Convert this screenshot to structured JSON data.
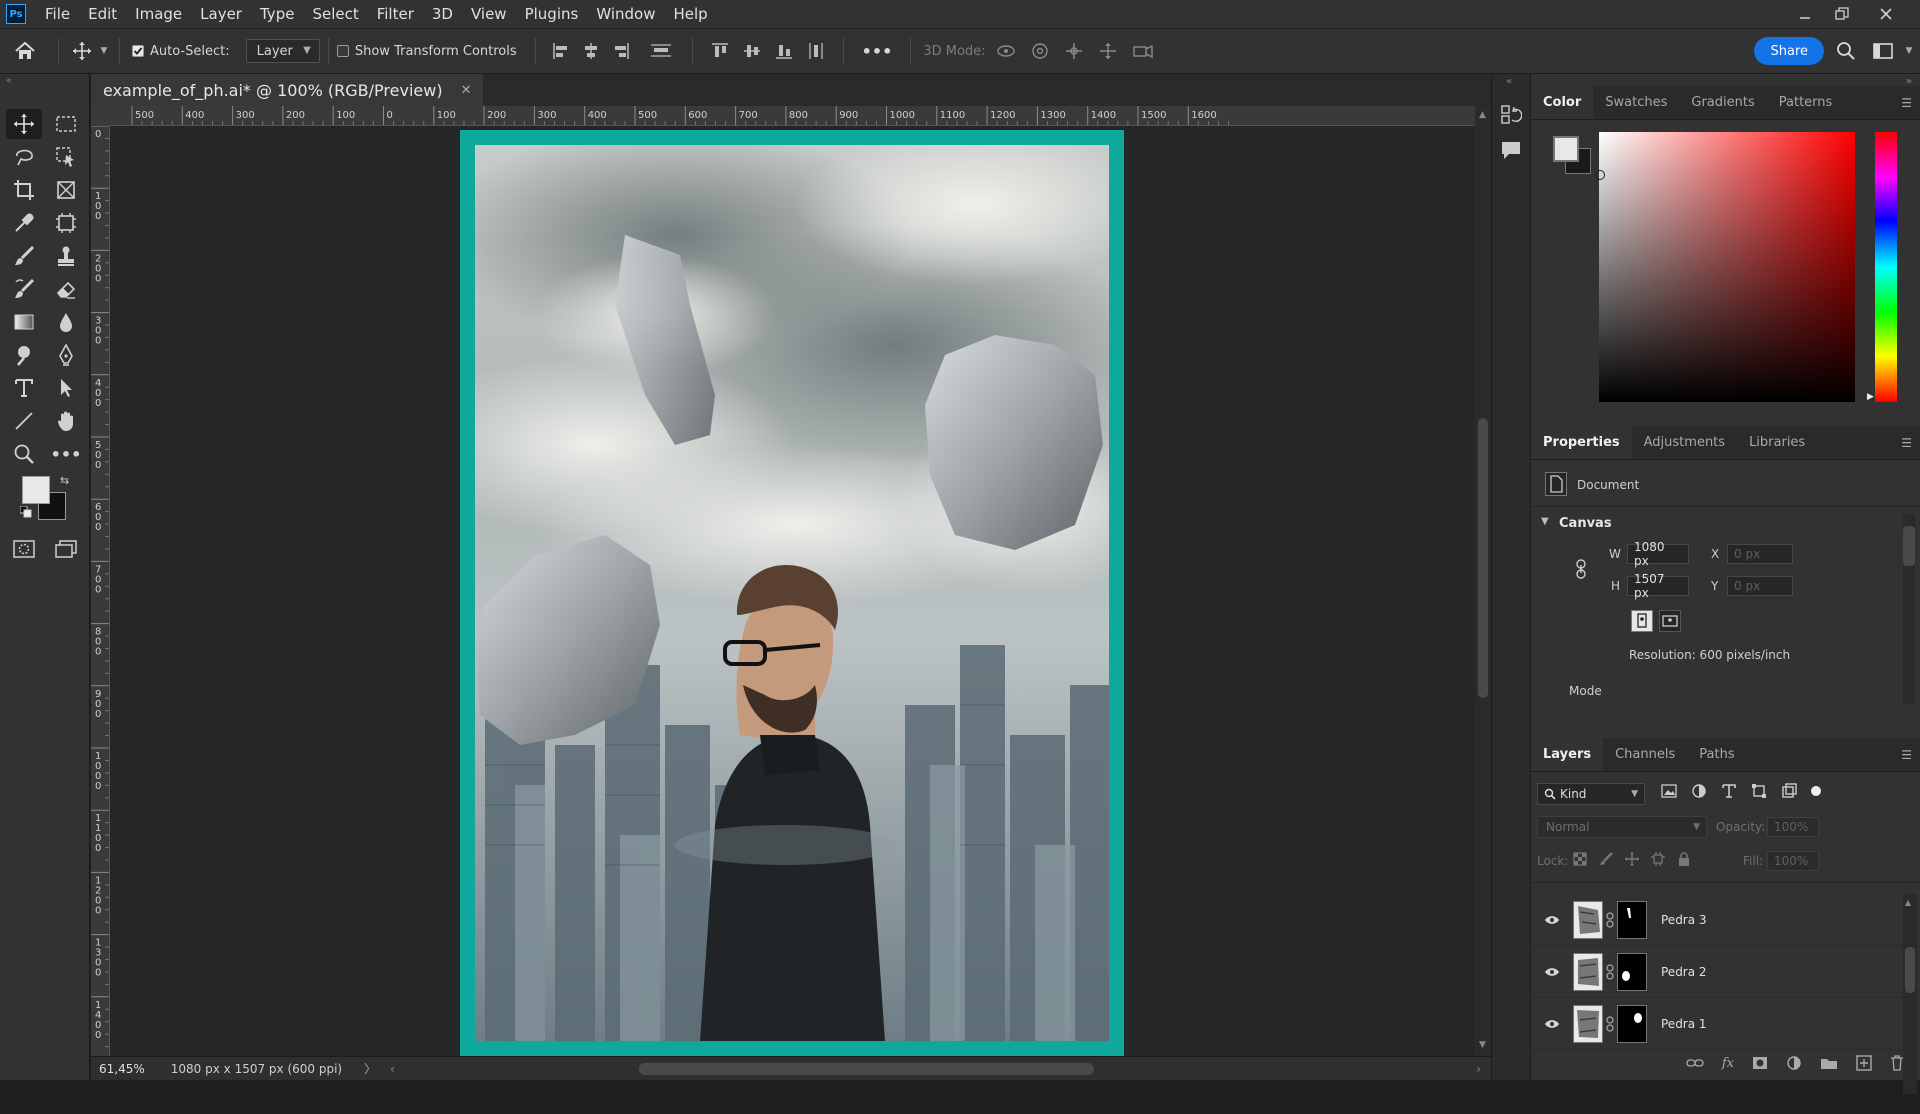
{
  "app": {
    "logo": "Ps"
  },
  "menu": [
    "File",
    "Edit",
    "Image",
    "Layer",
    "Type",
    "Select",
    "Filter",
    "3D",
    "View",
    "Plugins",
    "Window",
    "Help"
  ],
  "options": {
    "auto_select_label": "Auto-Select:",
    "auto_select_checked": true,
    "auto_select_target": "Layer",
    "show_transform_label": "Show Transform Controls",
    "mode_3d_label": "3D Mode:",
    "share_label": "Share",
    "more_label": "•••"
  },
  "document": {
    "tab_title": "example_of_ph.ai* @ 100% (RGB/Preview)",
    "frame_color": "#0fa89c"
  },
  "rulers": {
    "top_ticks": [
      "500",
      "400",
      "300",
      "200",
      "100",
      "0",
      "100",
      "200",
      "300",
      "400",
      "500",
      "600",
      "700",
      "800",
      "900",
      "1000",
      "1100",
      "1200",
      "1300",
      "1400",
      "1500",
      "1600"
    ],
    "left_ticks": [
      "0",
      "1 0 0",
      "2 0 0",
      "3 0 0",
      "4 0 0",
      "5 0 0",
      "6 0 0",
      "7 0 0",
      "8 0 0",
      "9 0 0",
      "1 0 0 0",
      "1 1 0 0",
      "1 2 0 0",
      "1 3 0 0",
      "1 4 0 0"
    ]
  },
  "status": {
    "zoom": "61,45%",
    "doc_info": "1080 px x 1507 px (600 ppi)"
  },
  "color_panel": {
    "tabs": [
      "Color",
      "Swatches",
      "Gradients",
      "Patterns"
    ],
    "active_tab": "Color",
    "hue_color": "#ff0000",
    "foreground": "#e8e8e8",
    "background": "#1a1a1a"
  },
  "properties_panel": {
    "tabs": [
      "Properties",
      "Adjustments",
      "Libraries"
    ],
    "active_tab": "Properties",
    "document_label": "Document",
    "canvas_label": "Canvas",
    "w_label": "W",
    "w_value": "1080 px",
    "h_label": "H",
    "h_value": "1507 px",
    "x_label": "X",
    "x_placeholder": "0 px",
    "y_label": "Y",
    "y_placeholder": "0 px",
    "resolution": "Resolution: 600 pixels/inch",
    "mode_label": "Mode"
  },
  "layers_panel": {
    "tabs": [
      "Layers",
      "Channels",
      "Paths"
    ],
    "active_tab": "Layers",
    "filter_kind": "Kind",
    "blend_mode": "Normal",
    "opacity_label": "Opacity:",
    "opacity_value": "100%",
    "lock_label": "Lock:",
    "fill_label": "Fill:",
    "fill_value": "100%",
    "layers": [
      {
        "name": "Pedra 3",
        "visible": true
      },
      {
        "name": "Pedra 2",
        "visible": true
      },
      {
        "name": "Pedra 1",
        "visible": true
      }
    ]
  }
}
